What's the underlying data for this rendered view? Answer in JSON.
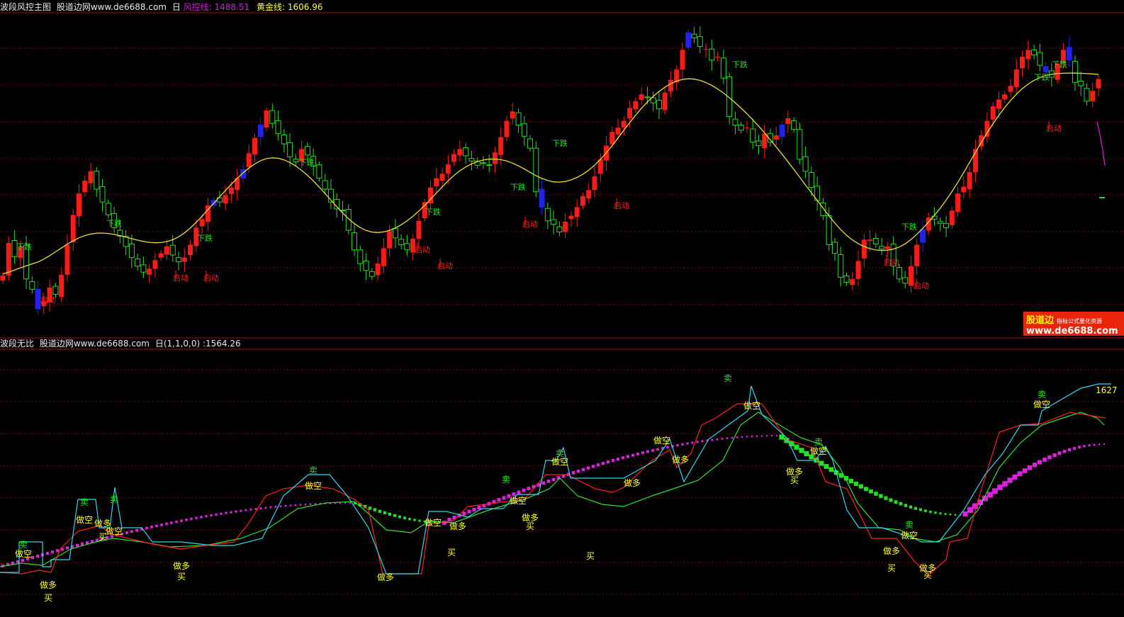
{
  "colors": {
    "background": "#000000",
    "grid": "#7a0000",
    "separator": "#aa1111",
    "up": "#ff1a1a",
    "down": "#22e022",
    "special": "#2222ee",
    "gold_line": "#e8e030",
    "risk_line": "#cc22cc",
    "cyan_line": "#30d8f0",
    "red_line": "#ff2020",
    "green_line": "#30e030",
    "label_yellow": "#ffff30",
    "label_green": "#22e022",
    "label_red": "#ff2020",
    "brand_bg": "#e8240a"
  },
  "top_panel": {
    "name": "波段风控主图",
    "site": "股道边网www.de6688.com",
    "period": "日",
    "risk_label": "风控线:",
    "risk_value": "1488.51",
    "gold_label": "黄金线:",
    "gold_value": "1606.96"
  },
  "bottom_panel": {
    "name": "波段无比",
    "site": "股道边网www.de6688.com",
    "params": "日(1,1,0,0)",
    "value": ":1564.26",
    "right_value": "1627"
  },
  "brand": {
    "name": "股道边",
    "tagline": "指标公式量化资源",
    "url": "www.de6688.com"
  },
  "chart_data": [
    {
      "type": "candlestick",
      "title": "波段风控主图",
      "ylim": [
        1280,
        1750
      ],
      "grid": true,
      "closes": [
        1434,
        1472,
        1456,
        1468,
        1430,
        1418,
        1395,
        1404,
        1420,
        1412,
        1435,
        1470,
        1505,
        1530,
        1545,
        1556,
        1535,
        1520,
        1505,
        1490,
        1480,
        1468,
        1455,
        1445,
        1438,
        1442,
        1452,
        1460,
        1468,
        1458,
        1450,
        1455,
        1470,
        1490,
        1500,
        1516,
        1522,
        1520,
        1528,
        1537,
        1548,
        1558,
        1577,
        1595,
        1610,
        1627,
        1612,
        1600,
        1588,
        1573,
        1567,
        1582,
        1575,
        1562,
        1548,
        1535,
        1520,
        1512,
        1510,
        1487,
        1464,
        1448,
        1440,
        1433,
        1448,
        1466,
        1486,
        1478,
        1470,
        1464,
        1477,
        1498,
        1520,
        1537,
        1548,
        1553,
        1564,
        1576,
        1582,
        1574,
        1568,
        1563,
        1565,
        1563,
        1578,
        1596,
        1615,
        1626,
        1610,
        1597,
        1583,
        1532,
        1514,
        1498,
        1494,
        1485,
        1497,
        1504,
        1514,
        1527,
        1534,
        1550,
        1570,
        1586,
        1602,
        1607,
        1615,
        1630,
        1638,
        1646,
        1642,
        1636,
        1629,
        1648,
        1663,
        1675,
        1698,
        1718,
        1712,
        1702,
        1699,
        1686,
        1690,
        1665,
        1620,
        1610,
        1604,
        1607,
        1590,
        1586,
        1600,
        1590,
        1598,
        1610,
        1618,
        1605,
        1570,
        1556,
        1537,
        1522,
        1504,
        1470,
        1460,
        1432,
        1426,
        1430,
        1451,
        1476,
        1476,
        1471,
        1465,
        1468,
        1445,
        1430,
        1425,
        1445,
        1470,
        1488,
        1502,
        1500,
        1495,
        1490,
        1510,
        1530,
        1538,
        1555,
        1582,
        1598,
        1615,
        1632,
        1640,
        1646,
        1656,
        1675,
        1690,
        1698,
        1692,
        1680,
        1672,
        1666,
        1682,
        1698,
        1686,
        1660,
        1656,
        1638,
        1650,
        1664
      ],
      "indicators": {
        "gold_line": {
          "name": "黄金线",
          "last": 1606.96
        },
        "risk_line": {
          "name": "风控线",
          "last": 1488.51
        }
      },
      "annotations": [
        "下跌",
        "启动"
      ]
    },
    {
      "type": "line",
      "title": "波段无比",
      "ylim": [
        1300,
        1720
      ],
      "grid": true,
      "series": [
        {
          "name": "cyan_line"
        },
        {
          "name": "red_line"
        },
        {
          "name": "green_line"
        },
        {
          "name": "dotted_trend"
        }
      ],
      "labels": [
        "卖",
        "做空",
        "做多",
        "买"
      ]
    }
  ],
  "top_labels": [
    {
      "text": "下跌",
      "x": 34,
      "y": 352,
      "c": "g"
    },
    {
      "text": "启动",
      "x": 68,
      "y": 427,
      "c": "r"
    },
    {
      "text": "下跌",
      "x": 161,
      "y": 319,
      "c": "g"
    },
    {
      "text": "启动",
      "x": 255,
      "y": 396,
      "c": "r"
    },
    {
      "text": "下跌",
      "x": 289,
      "y": 340,
      "c": "g"
    },
    {
      "text": "启动",
      "x": 298,
      "y": 396,
      "c": "r"
    },
    {
      "text": "下跌",
      "x": 433,
      "y": 233,
      "c": "g"
    },
    {
      "text": "启动",
      "x": 596,
      "y": 356,
      "c": "r"
    },
    {
      "text": "下跌",
      "x": 611,
      "y": 303,
      "c": "g"
    },
    {
      "text": "启动",
      "x": 628,
      "y": 379,
      "c": "r"
    },
    {
      "text": "下跌",
      "x": 731,
      "y": 268,
      "c": "g"
    },
    {
      "text": "启动",
      "x": 748,
      "y": 320,
      "c": "r"
    },
    {
      "text": "下跌",
      "x": 790,
      "y": 206,
      "c": "g"
    },
    {
      "text": "启动",
      "x": 877,
      "y": 294,
      "c": "r"
    },
    {
      "text": "下跌",
      "x": 1044,
      "y": 95,
      "c": "g"
    },
    {
      "text": "启动",
      "x": 1258,
      "y": 374,
      "c": "r"
    },
    {
      "text": "下跌",
      "x": 1283,
      "y": 324,
      "c": "g"
    },
    {
      "text": "启动",
      "x": 1300,
      "y": 407,
      "c": "r"
    },
    {
      "text": "下跌",
      "x": 1470,
      "y": 113,
      "c": "g"
    },
    {
      "text": "下跌",
      "x": 1495,
      "y": 95,
      "c": "g"
    },
    {
      "text": "启动",
      "x": 1487,
      "y": 185,
      "c": "r"
    }
  ],
  "bottom_labels": [
    {
      "text": "卖",
      "x": 33,
      "y": 773,
      "c": "g"
    },
    {
      "text": "做空",
      "x": 33,
      "y": 786,
      "c": "y"
    },
    {
      "text": "做多",
      "x": 68,
      "y": 830,
      "c": "y"
    },
    {
      "text": "买",
      "x": 68,
      "y": 848,
      "c": "y"
    },
    {
      "text": "卖",
      "x": 119,
      "y": 713,
      "c": "g"
    },
    {
      "text": "做空",
      "x": 119,
      "y": 738,
      "c": "y"
    },
    {
      "text": "做多",
      "x": 145,
      "y": 743,
      "c": "y"
    },
    {
      "text": "买",
      "x": 145,
      "y": 762,
      "c": "y"
    },
    {
      "text": "卖",
      "x": 161,
      "y": 709,
      "c": "g"
    },
    {
      "text": "做空",
      "x": 161,
      "y": 754,
      "c": "y"
    },
    {
      "text": "做多",
      "x": 256,
      "y": 803,
      "c": "y"
    },
    {
      "text": "买",
      "x": 256,
      "y": 818,
      "c": "y"
    },
    {
      "text": "卖",
      "x": 442,
      "y": 668,
      "c": "g"
    },
    {
      "text": "做空",
      "x": 442,
      "y": 690,
      "c": "y"
    },
    {
      "text": "做多",
      "x": 544,
      "y": 819,
      "c": "y"
    },
    {
      "text": "做空",
      "x": 611,
      "y": 742,
      "c": "y"
    },
    {
      "text": "做多",
      "x": 646,
      "y": 747,
      "c": "y"
    },
    {
      "text": "买",
      "x": 637,
      "y": 784,
      "c": "y"
    },
    {
      "text": "卖",
      "x": 714,
      "y": 681,
      "c": "g"
    },
    {
      "text": "做空",
      "x": 731,
      "y": 711,
      "c": "y"
    },
    {
      "text": "做多",
      "x": 748,
      "y": 735,
      "c": "y"
    },
    {
      "text": "买",
      "x": 748,
      "y": 747,
      "c": "y"
    },
    {
      "text": "卖",
      "x": 790,
      "y": 644,
      "c": "g"
    },
    {
      "text": "做空",
      "x": 790,
      "y": 656,
      "c": "y"
    },
    {
      "text": "买",
      "x": 833,
      "y": 789,
      "c": "y"
    },
    {
      "text": "做多",
      "x": 892,
      "y": 686,
      "c": "y"
    },
    {
      "text": "做空",
      "x": 934,
      "y": 626,
      "c": "y"
    },
    {
      "text": "做多",
      "x": 960,
      "y": 653,
      "c": "y"
    },
    {
      "text": "卖",
      "x": 1027,
      "y": 538,
      "c": "g"
    },
    {
      "text": "做空",
      "x": 1061,
      "y": 577,
      "c": "y"
    },
    {
      "text": "卖",
      "x": 1155,
      "y": 628,
      "c": "g"
    },
    {
      "text": "做空",
      "x": 1155,
      "y": 641,
      "c": "y"
    },
    {
      "text": "做多",
      "x": 1121,
      "y": 670,
      "c": "y"
    },
    {
      "text": "买",
      "x": 1121,
      "y": 682,
      "c": "y"
    },
    {
      "text": "卖",
      "x": 1283,
      "y": 745,
      "c": "g"
    },
    {
      "text": "做空",
      "x": 1283,
      "y": 760,
      "c": "y"
    },
    {
      "text": "做多",
      "x": 1258,
      "y": 782,
      "c": "y"
    },
    {
      "text": "买",
      "x": 1258,
      "y": 806,
      "c": "y"
    },
    {
      "text": "做多",
      "x": 1309,
      "y": 806,
      "c": "y"
    },
    {
      "text": "买",
      "x": 1309,
      "y": 816,
      "c": "y"
    },
    {
      "text": "卖",
      "x": 1470,
      "y": 561,
      "c": "g"
    },
    {
      "text": "做空",
      "x": 1470,
      "y": 575,
      "c": "y"
    }
  ]
}
